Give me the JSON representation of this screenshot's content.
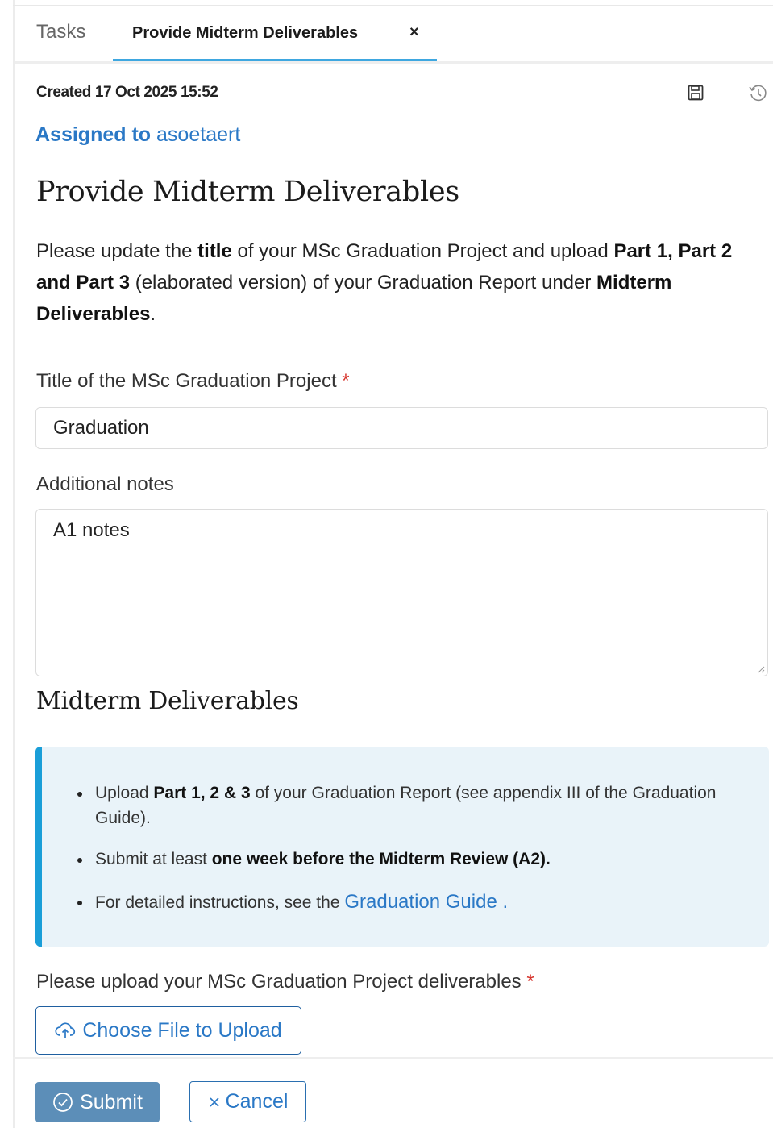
{
  "tabs": {
    "tasks_label": "Tasks",
    "active_label": "Provide Midterm Deliverables",
    "close_glyph": "×"
  },
  "meta": {
    "created": "Created 17 Oct 2025 15:52",
    "assigned_prefix": "Assigned to",
    "assignee": "asoetaert",
    "icons": [
      "save-icon",
      "history-icon"
    ]
  },
  "page_title": "Provide Midterm Deliverables",
  "intro": {
    "t1": "Please update the ",
    "b1": "title",
    "t2": " of your MSc Graduation Project and upload ",
    "b2": "Part 1, Part 2 and Part 3",
    "t3": " (elaborated version) of your Graduation Report under ",
    "b3": "Midterm Deliverables",
    "t4": "."
  },
  "form": {
    "title_field": {
      "label": "Title of the MSc Graduation Project",
      "required_mark": "*",
      "value": "Graduation"
    },
    "notes_field": {
      "label": "Additional notes",
      "value": "A1 notes"
    }
  },
  "deliverables": {
    "section_title": "Midterm Deliverables",
    "info": {
      "item1": {
        "t1": "Upload ",
        "b1": "Part 1, 2 & 3",
        "t2": " of your Graduation Report (see appendix III of the Graduation Guide)."
      },
      "item2": {
        "t1": "Submit at least ",
        "b1": "one week before the Midterm Review (A2)."
      },
      "item3": {
        "t1": "For detailed instructions, see the ",
        "link": "Graduation Guide",
        "t2": " ."
      }
    },
    "upload_label": "Please upload your MSc Graduation Project deliverables",
    "required_mark": "*",
    "upload_button": "Choose File to Upload"
  },
  "actions": {
    "submit": "Submit",
    "cancel": "Cancel"
  },
  "colors": {
    "accent_blue": "#2a78c6",
    "tab_underline": "#3ea7e0",
    "info_bg": "#e9f3f9",
    "info_border": "#1a9ed8",
    "submit_bg": "#5c8eb8",
    "required": "#d6342c"
  }
}
